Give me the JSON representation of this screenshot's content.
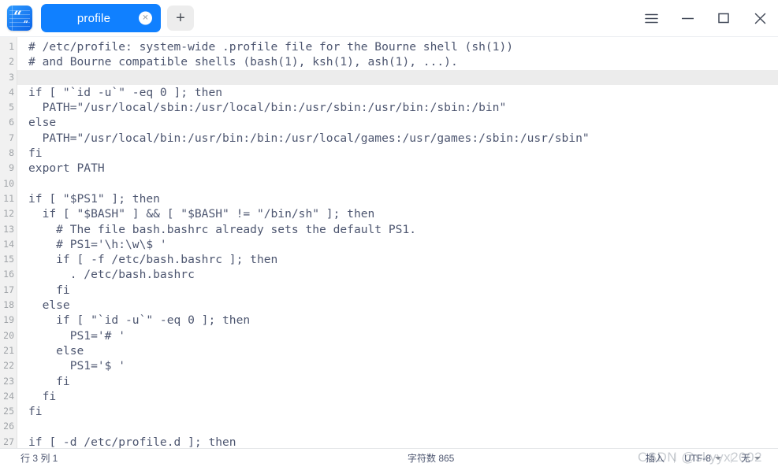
{
  "window": {
    "app_icon_name": "notepad-quotes-icon",
    "controls": [
      {
        "name": "menu-button",
        "icon": "hamburger-icon"
      },
      {
        "name": "minimize-button",
        "icon": "minimize-icon"
      },
      {
        "name": "maximize-button",
        "icon": "maximize-icon"
      },
      {
        "name": "close-button",
        "icon": "close-icon"
      }
    ]
  },
  "tabs": {
    "items": [
      {
        "label": "profile",
        "active": true,
        "close_glyph": "✕"
      }
    ],
    "new_tab_glyph": "+"
  },
  "editor": {
    "current_line": 3,
    "lines": [
      {
        "n": "1",
        "text": "# /etc/profile: system-wide .profile file for the Bourne shell (sh(1))"
      },
      {
        "n": "2",
        "text": "# and Bourne compatible shells (bash(1), ksh(1), ash(1), ...)."
      },
      {
        "n": "3",
        "text": ""
      },
      {
        "n": "4",
        "text": "if [ \"`id -u`\" -eq 0 ]; then"
      },
      {
        "n": "5",
        "text": "  PATH=\"/usr/local/sbin:/usr/local/bin:/usr/sbin:/usr/bin:/sbin:/bin\""
      },
      {
        "n": "6",
        "text": "else"
      },
      {
        "n": "7",
        "text": "  PATH=\"/usr/local/bin:/usr/bin:/bin:/usr/local/games:/usr/games:/sbin:/usr/sbin\""
      },
      {
        "n": "8",
        "text": "fi"
      },
      {
        "n": "9",
        "text": "export PATH"
      },
      {
        "n": "10",
        "text": ""
      },
      {
        "n": "11",
        "text": "if [ \"$PS1\" ]; then"
      },
      {
        "n": "12",
        "text": "  if [ \"$BASH\" ] && [ \"$BASH\" != \"/bin/sh\" ]; then"
      },
      {
        "n": "13",
        "text": "    # The file bash.bashrc already sets the default PS1."
      },
      {
        "n": "14",
        "text": "    # PS1='\\h:\\w\\$ '"
      },
      {
        "n": "15",
        "text": "    if [ -f /etc/bash.bashrc ]; then"
      },
      {
        "n": "16",
        "text": "      . /etc/bash.bashrc"
      },
      {
        "n": "17",
        "text": "    fi"
      },
      {
        "n": "18",
        "text": "  else"
      },
      {
        "n": "19",
        "text": "    if [ \"`id -u`\" -eq 0 ]; then"
      },
      {
        "n": "20",
        "text": "      PS1='# '"
      },
      {
        "n": "21",
        "text": "    else"
      },
      {
        "n": "22",
        "text": "      PS1='$ '"
      },
      {
        "n": "23",
        "text": "    fi"
      },
      {
        "n": "24",
        "text": "  fi"
      },
      {
        "n": "25",
        "text": "fi"
      },
      {
        "n": "26",
        "text": ""
      },
      {
        "n": "27",
        "text": "if [ -d /etc/profile.d ]; then"
      }
    ]
  },
  "statusbar": {
    "cursor": "行 3  列 1",
    "chars": "字符数 865",
    "mode": "插入",
    "encoding": "UTF-8",
    "line_ending": "无"
  },
  "watermark": "CSDN @skyyx2002",
  "colors": {
    "tab_active": "#1080ff",
    "gutter_bg": "#f1f1f1",
    "current_line_bg": "#ececec",
    "code_text": "#4d5670",
    "new_tab_bg": "#ededed"
  }
}
